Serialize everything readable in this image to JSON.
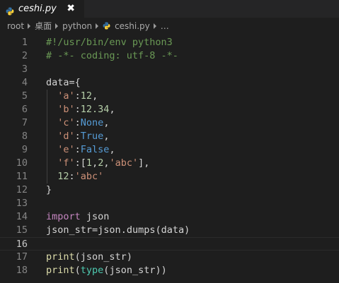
{
  "tab": {
    "label": "ceshi.py",
    "close": "✖"
  },
  "breadcrumb": {
    "items": [
      "root",
      "桌面",
      "python",
      "ceshi.py"
    ],
    "more": "…"
  },
  "editor": {
    "current_line": 16,
    "lines": [
      {
        "n": "1",
        "tokens": [
          {
            "t": "#!/usr/bin/env python3",
            "c": "comment"
          }
        ]
      },
      {
        "n": "2",
        "tokens": [
          {
            "t": "# -*- coding: utf-8 -*-",
            "c": "comment"
          }
        ]
      },
      {
        "n": "3",
        "tokens": []
      },
      {
        "n": "4",
        "tokens": [
          {
            "t": "data",
            "c": "var"
          },
          {
            "t": "={",
            "c": "punc"
          }
        ]
      },
      {
        "n": "5",
        "tokens": [
          {
            "t": "  ",
            "c": "punc"
          },
          {
            "t": "'a'",
            "c": "str"
          },
          {
            "t": ":",
            "c": "punc"
          },
          {
            "t": "12",
            "c": "num"
          },
          {
            "t": ",",
            "c": "punc"
          }
        ]
      },
      {
        "n": "6",
        "tokens": [
          {
            "t": "  ",
            "c": "punc"
          },
          {
            "t": "'b'",
            "c": "str"
          },
          {
            "t": ":",
            "c": "punc"
          },
          {
            "t": "12.34",
            "c": "num"
          },
          {
            "t": ",",
            "c": "punc"
          }
        ]
      },
      {
        "n": "7",
        "tokens": [
          {
            "t": "  ",
            "c": "punc"
          },
          {
            "t": "'c'",
            "c": "str"
          },
          {
            "t": ":",
            "c": "punc"
          },
          {
            "t": "None",
            "c": "const"
          },
          {
            "t": ",",
            "c": "punc"
          }
        ]
      },
      {
        "n": "8",
        "tokens": [
          {
            "t": "  ",
            "c": "punc"
          },
          {
            "t": "'d'",
            "c": "str"
          },
          {
            "t": ":",
            "c": "punc"
          },
          {
            "t": "True",
            "c": "const"
          },
          {
            "t": ",",
            "c": "punc"
          }
        ]
      },
      {
        "n": "9",
        "tokens": [
          {
            "t": "  ",
            "c": "punc"
          },
          {
            "t": "'e'",
            "c": "str"
          },
          {
            "t": ":",
            "c": "punc"
          },
          {
            "t": "False",
            "c": "const"
          },
          {
            "t": ",",
            "c": "punc"
          }
        ]
      },
      {
        "n": "10",
        "tokens": [
          {
            "t": "  ",
            "c": "punc"
          },
          {
            "t": "'f'",
            "c": "str"
          },
          {
            "t": ":[",
            "c": "punc"
          },
          {
            "t": "1",
            "c": "num"
          },
          {
            "t": ",",
            "c": "punc"
          },
          {
            "t": "2",
            "c": "num"
          },
          {
            "t": ",",
            "c": "punc"
          },
          {
            "t": "'abc'",
            "c": "str"
          },
          {
            "t": "],",
            "c": "punc"
          }
        ]
      },
      {
        "n": "11",
        "tokens": [
          {
            "t": "  ",
            "c": "punc"
          },
          {
            "t": "12",
            "c": "num"
          },
          {
            "t": ":",
            "c": "punc"
          },
          {
            "t": "'abc'",
            "c": "str"
          }
        ]
      },
      {
        "n": "12",
        "tokens": [
          {
            "t": "}",
            "c": "punc"
          }
        ]
      },
      {
        "n": "13",
        "tokens": []
      },
      {
        "n": "14",
        "tokens": [
          {
            "t": "import",
            "c": "kw"
          },
          {
            "t": " json",
            "c": "var"
          }
        ]
      },
      {
        "n": "15",
        "tokens": [
          {
            "t": "json_str",
            "c": "var"
          },
          {
            "t": "=",
            "c": "punc"
          },
          {
            "t": "json",
            "c": "var"
          },
          {
            "t": ".",
            "c": "punc"
          },
          {
            "t": "dumps",
            "c": "var"
          },
          {
            "t": "(",
            "c": "punc"
          },
          {
            "t": "data",
            "c": "var"
          },
          {
            "t": ")",
            "c": "punc"
          }
        ]
      },
      {
        "n": "16",
        "tokens": []
      },
      {
        "n": "17",
        "tokens": [
          {
            "t": "print",
            "c": "fn"
          },
          {
            "t": "(",
            "c": "punc"
          },
          {
            "t": "json_str",
            "c": "var"
          },
          {
            "t": ")",
            "c": "punc"
          }
        ]
      },
      {
        "n": "18",
        "tokens": [
          {
            "t": "print",
            "c": "fn"
          },
          {
            "t": "(",
            "c": "punc"
          },
          {
            "t": "type",
            "c": "builtin"
          },
          {
            "t": "(",
            "c": "punc"
          },
          {
            "t": "json_str",
            "c": "var"
          },
          {
            "t": "))",
            "c": "punc"
          }
        ]
      }
    ]
  },
  "colors": {
    "background": "#1e1e1e",
    "tabbar": "#252526",
    "comment": "#6a9955",
    "string": "#ce9178",
    "number": "#b5cea8",
    "constant": "#569cd6",
    "keyword": "#c586c0",
    "function": "#dcdcaa",
    "builtin": "#4ec9b0",
    "python_icon_blue": "#3572a5",
    "python_icon_yellow": "#ffd43b"
  }
}
